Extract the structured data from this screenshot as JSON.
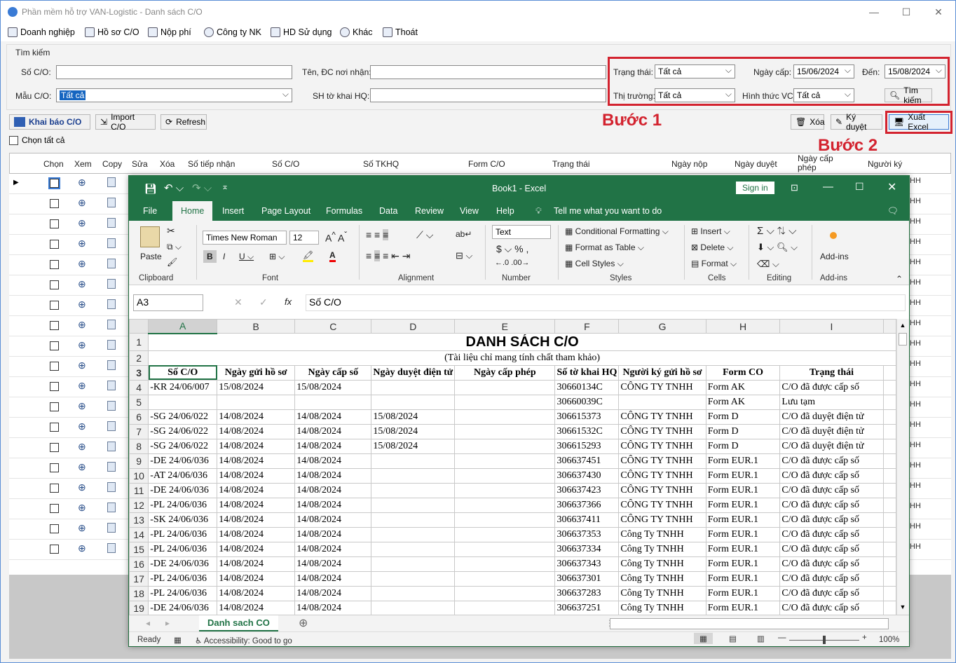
{
  "window": {
    "title": "Phần mềm hỗ trợ VAN-Logistic - Danh sách C/O"
  },
  "menu": [
    "Doanh nghiệp",
    "Hồ sơ C/O",
    "Nộp phí",
    "Công ty NK",
    "HD Sử dụng",
    "Khác",
    "Thoát"
  ],
  "search": {
    "group_label": "Tìm kiếm",
    "so_co_label": "Số C/O:",
    "mau_co_label": "Mẫu C/O:",
    "mau_co_value": "Tất cả",
    "ten_dc_label": "Tên, ĐC nơi nhận:",
    "sh_to_khai_label": "SH tờ khai HQ:",
    "trang_thai_label": "Trạng thái:",
    "trang_thai_value": "Tất cả",
    "thi_truong_label": "Thị trường:",
    "thi_truong_value": "Tất cả",
    "ngay_cap_label": "Ngày cấp:",
    "ngay_cap_value": "15/06/2024",
    "den_label": "Đến:",
    "den_value": "15/08/2024",
    "hinh_thuc_label": "Hình thức VC:",
    "hinh_thuc_value": "Tất cả",
    "search_button": "Tìm kiếm"
  },
  "toolbar": {
    "khai_bao": "Khai báo C/O",
    "import": "Import C/O",
    "refresh": "Refresh",
    "xoa": "Xóa",
    "ky_duyet": "Ký duyệt",
    "xuat_excel": "Xuất Excel",
    "chon_tat_ca": "Chọn tất cả"
  },
  "annotations": {
    "step1": "Bước 1",
    "step2": "Bước 2"
  },
  "grid": {
    "columns": [
      "Chọn",
      "Xem",
      "Copy",
      "Sửa",
      "Xóa",
      "Số tiếp nhận",
      "Số C/O",
      "Số TKHQ",
      "Form C/O",
      "Trạng thái",
      "Ngày nộp",
      "Ngày duyệt",
      "Ngày cấp phép",
      "Người ký"
    ],
    "row_suffix": "HH"
  },
  "excel": {
    "title": "Book1 - Excel",
    "sign_in": "Sign in",
    "tabs": [
      "File",
      "Home",
      "Insert",
      "Page Layout",
      "Formulas",
      "Data",
      "Review",
      "View",
      "Help"
    ],
    "tell_me": "Tell me what you want to do",
    "ribbon": {
      "paste": "Paste",
      "clipboard": "Clipboard",
      "font_name": "Times New Roman",
      "font_size": "12",
      "font": "Font",
      "alignment": "Alignment",
      "number_format": "Text",
      "number": "Number",
      "conditional": "Conditional Formatting",
      "format_table": "Format as Table",
      "cell_styles": "Cell Styles",
      "styles": "Styles",
      "insert": "Insert",
      "delete": "Delete",
      "format": "Format",
      "cells": "Cells",
      "editing": "Editing",
      "addins": "Add-ins",
      "addins_group": "Add-ins"
    },
    "name_box": "A3",
    "formula": "Số C/O",
    "col_letters": [
      "A",
      "B",
      "C",
      "D",
      "E",
      "F",
      "G",
      "H",
      "I"
    ],
    "sheet_title": "DANH SÁCH C/O",
    "sheet_subtitle": "(Tài liệu chỉ mang tính chất tham khảo)",
    "headers": [
      "Số C/O",
      "Ngày gửi hồ sơ",
      "Ngày cấp số",
      "Ngày duyệt điện tử",
      "Ngày cấp phép",
      "Số tờ khai HQ",
      "Người ký gửi hồ sơ",
      "Form CO",
      "Trạng thái"
    ],
    "rows": [
      {
        "n": "4",
        "a": "-KR 24/06/007",
        "b": "15/08/2024",
        "c": "15/08/2024",
        "d": "",
        "f": "30660134C",
        "g": "CÔNG TY TNHH",
        "h": "Form AK",
        "i": "C/O đã được cấp số"
      },
      {
        "n": "5",
        "a": "",
        "b": "",
        "c": "",
        "d": "",
        "f": "30660039C",
        "g": "",
        "h": "Form AK",
        "i": "Lưu tạm"
      },
      {
        "n": "6",
        "a": "-SG 24/06/022",
        "b": "14/08/2024",
        "c": "14/08/2024",
        "d": "15/08/2024",
        "f": "306615373",
        "g": "CÔNG TY TNHH",
        "h": "Form D",
        "i": "C/O đã duyệt điện tử"
      },
      {
        "n": "7",
        "a": "-SG 24/06/022",
        "b": "14/08/2024",
        "c": "14/08/2024",
        "d": "15/08/2024",
        "f": "30661532C",
        "g": "CÔNG TY TNHH",
        "h": "Form D",
        "i": "C/O đã duyệt điện tử"
      },
      {
        "n": "8",
        "a": "-SG 24/06/022",
        "b": "14/08/2024",
        "c": "14/08/2024",
        "d": "15/08/2024",
        "f": "306615293",
        "g": "CÔNG TY TNHH",
        "h": "Form D",
        "i": "C/O đã duyệt điện tử"
      },
      {
        "n": "9",
        "a": "-DE 24/06/036",
        "b": "14/08/2024",
        "c": "14/08/2024",
        "d": "",
        "f": "306637451",
        "g": "CÔNG TY TNHH",
        "h": "Form EUR.1",
        "i": "C/O đã được cấp số"
      },
      {
        "n": "10",
        "a": "-AT 24/06/036",
        "b": "14/08/2024",
        "c": "14/08/2024",
        "d": "",
        "f": "306637430",
        "g": "CÔNG TY TNHH",
        "h": "Form EUR.1",
        "i": "C/O đã được cấp số"
      },
      {
        "n": "11",
        "a": "-DE 24/06/036",
        "b": "14/08/2024",
        "c": "14/08/2024",
        "d": "",
        "f": "306637423",
        "g": "CÔNG TY TNHH",
        "h": "Form EUR.1",
        "i": "C/O đã được cấp số"
      },
      {
        "n": "12",
        "a": "-PL 24/06/036",
        "b": "14/08/2024",
        "c": "14/08/2024",
        "d": "",
        "f": "306637366",
        "g": "CÔNG TY TNHH",
        "h": "Form EUR.1",
        "i": "C/O đã được cấp số"
      },
      {
        "n": "13",
        "a": "-SK 24/06/036",
        "b": "14/08/2024",
        "c": "14/08/2024",
        "d": "",
        "f": "306637411",
        "g": "CÔNG TY TNHH",
        "h": "Form EUR.1",
        "i": "C/O đã được cấp số"
      },
      {
        "n": "14",
        "a": "-PL 24/06/036",
        "b": "14/08/2024",
        "c": "14/08/2024",
        "d": "",
        "f": "306637353",
        "g": "Công Ty TNHH",
        "h": "Form EUR.1",
        "i": "C/O đã được cấp số"
      },
      {
        "n": "15",
        "a": "-PL 24/06/036",
        "b": "14/08/2024",
        "c": "14/08/2024",
        "d": "",
        "f": "306637334",
        "g": "Công Ty TNHH",
        "h": "Form EUR.1",
        "i": "C/O đã được cấp số"
      },
      {
        "n": "16",
        "a": "-DE 24/06/036",
        "b": "14/08/2024",
        "c": "14/08/2024",
        "d": "",
        "f": "306637343",
        "g": "Công Ty TNHH",
        "h": "Form EUR.1",
        "i": "C/O đã được cấp số"
      },
      {
        "n": "17",
        "a": "-PL 24/06/036",
        "b": "14/08/2024",
        "c": "14/08/2024",
        "d": "",
        "f": "306637301",
        "g": "Công Ty TNHH",
        "h": "Form EUR.1",
        "i": "C/O đã được cấp số"
      },
      {
        "n": "18",
        "a": "-PL 24/06/036",
        "b": "14/08/2024",
        "c": "14/08/2024",
        "d": "",
        "f": "306637283",
        "g": "Công Ty TNHH",
        "h": "Form EUR.1",
        "i": "C/O đã được cấp số"
      },
      {
        "n": "19",
        "a": "-DE 24/06/036",
        "b": "14/08/2024",
        "c": "14/08/2024",
        "d": "",
        "f": "306637251",
        "g": "Công Ty TNHH",
        "h": "Form EUR.1",
        "i": "C/O đã được cấp số"
      }
    ],
    "sheet_tab": "Danh sach CO",
    "status_ready": "Ready",
    "accessibility": "Accessibility: Good to go",
    "zoom": "100%"
  },
  "colors": {
    "excel_green": "#217346",
    "annotation_red": "#d3232f"
  }
}
